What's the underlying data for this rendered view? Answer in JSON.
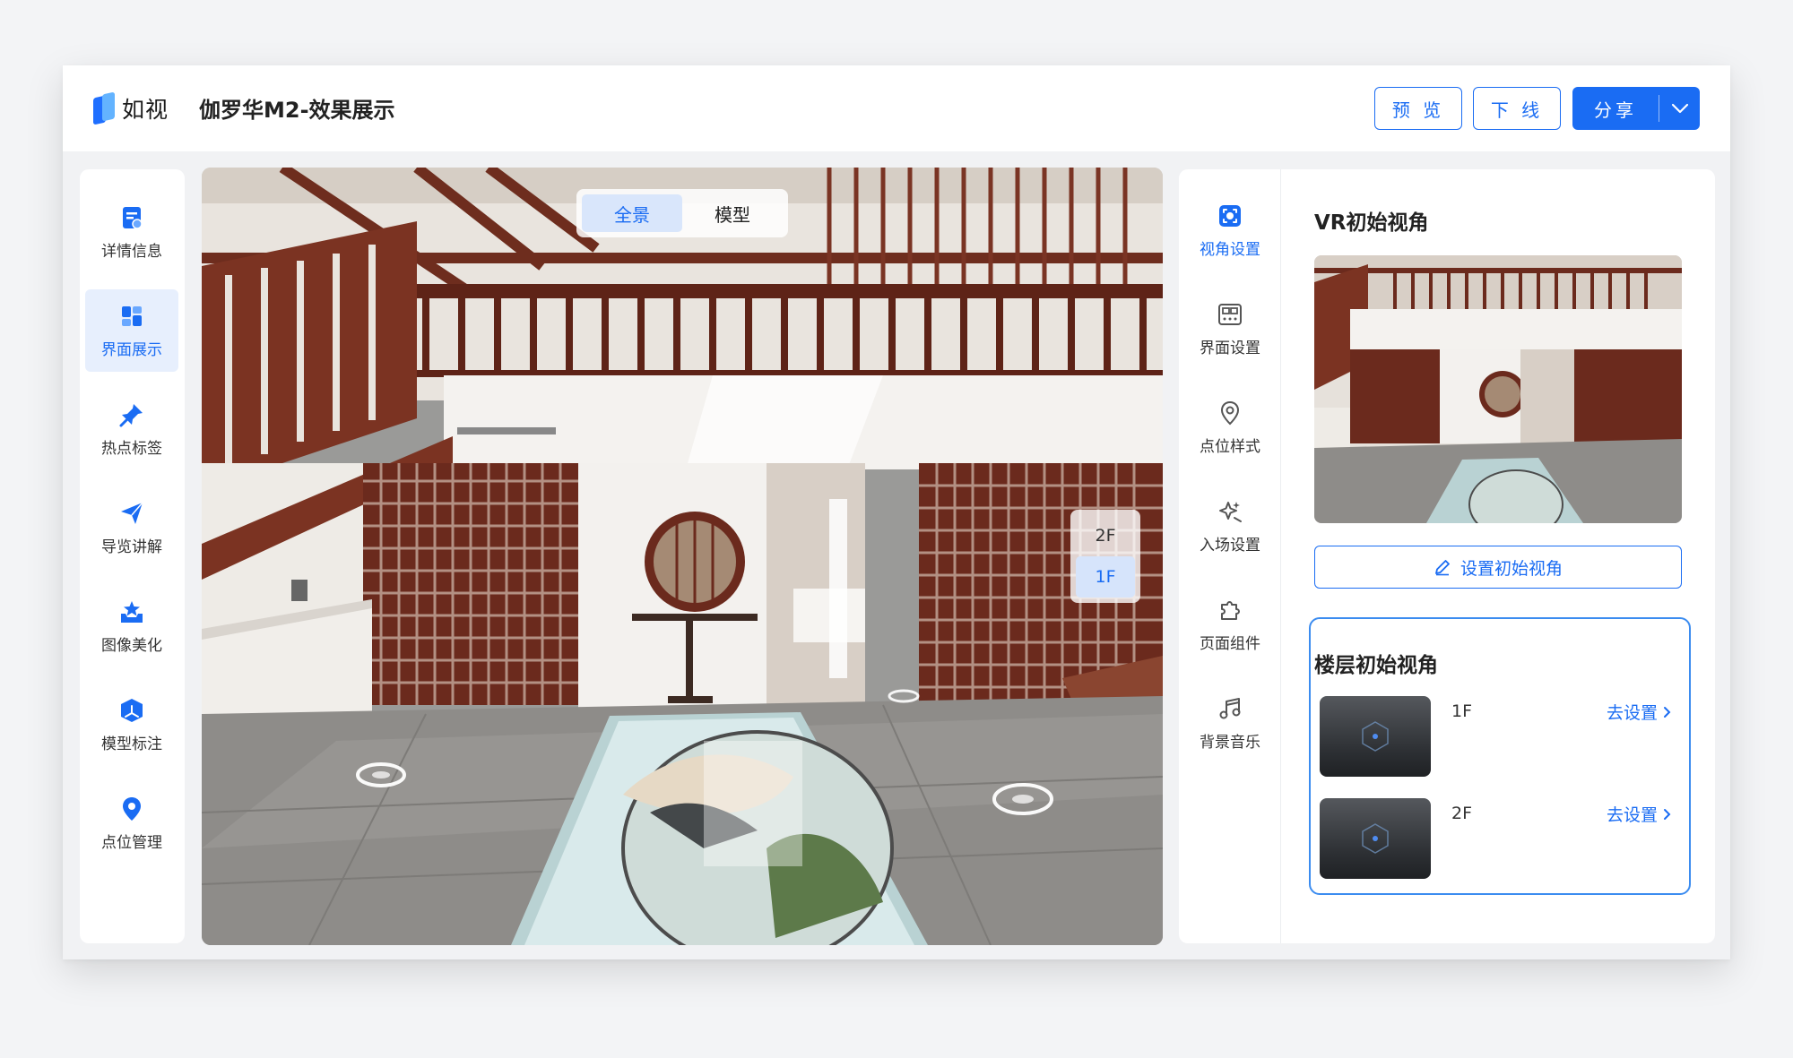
{
  "header": {
    "logo_text": "如视",
    "project_title": "伽罗华M2-效果展示",
    "preview_label": "预 览",
    "offline_label": "下 线",
    "share_label": "分享"
  },
  "left_sidebar": {
    "items": [
      {
        "label": "详情信息",
        "icon": "document-info-icon"
      },
      {
        "label": "界面展示",
        "icon": "layout-icon"
      },
      {
        "label": "热点标签",
        "icon": "pin-icon"
      },
      {
        "label": "导览讲解",
        "icon": "paper-plane-icon"
      },
      {
        "label": "图像美化",
        "icon": "star-tray-icon"
      },
      {
        "label": "模型标注",
        "icon": "cube-icon"
      },
      {
        "label": "点位管理",
        "icon": "location-icon"
      }
    ],
    "active_index": 1
  },
  "viewer": {
    "view_modes": [
      "全景",
      "模型"
    ],
    "active_mode": "全景",
    "floors": [
      "2F",
      "1F"
    ],
    "active_floor": "1F"
  },
  "right_panel": {
    "tabs": [
      {
        "label": "视角设置",
        "icon": "viewpoint-icon"
      },
      {
        "label": "界面设置",
        "icon": "interface-settings-icon"
      },
      {
        "label": "点位样式",
        "icon": "location-style-icon"
      },
      {
        "label": "入场设置",
        "icon": "sparkle-icon"
      },
      {
        "label": "页面组件",
        "icon": "puzzle-icon"
      },
      {
        "label": "背景音乐",
        "icon": "music-note-icon"
      }
    ],
    "active_tab": "视角设置",
    "vr_title": "VR初始视角",
    "set_view_label": "设置初始视角",
    "floor_title": "楼层初始视角",
    "floor_rows": [
      {
        "floor": "1F",
        "action": "去设置"
      },
      {
        "floor": "2F",
        "action": "去设置"
      }
    ]
  },
  "colors": {
    "accent": "#1a6cf3",
    "active_bg": "#e7effd",
    "card_border": "#3b8cf0"
  }
}
